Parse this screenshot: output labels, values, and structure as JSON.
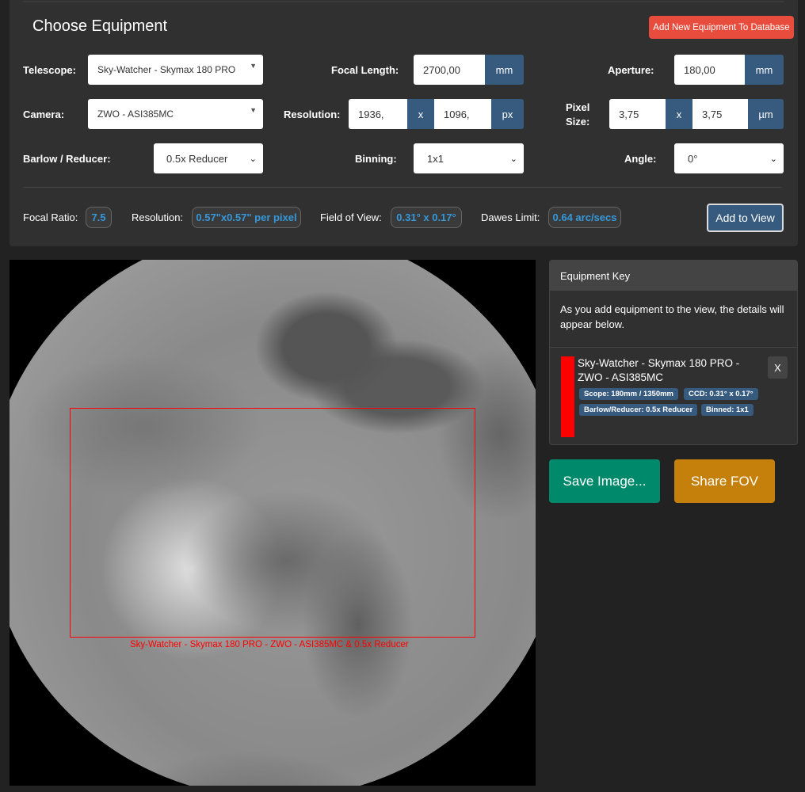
{
  "header": {
    "title": "Choose Equipment",
    "add_db_label": "Add New Equipment To Database"
  },
  "form": {
    "telescope": {
      "label": "Telescope:",
      "value": "Sky-Watcher - Skymax 180 PRO"
    },
    "focal_length": {
      "label": "Focal Length:",
      "value": "2700,00",
      "unit": "mm"
    },
    "aperture": {
      "label": "Aperture:",
      "value": "180,00",
      "unit": "mm"
    },
    "camera": {
      "label": "Camera:",
      "value": "ZWO - ASI385MC"
    },
    "resolution": {
      "label": "Resolution:",
      "x": "1936,",
      "sep": "x",
      "y": "1096,",
      "unit": "px"
    },
    "pixel_size": {
      "label_1": "Pixel",
      "label_2": "Size:",
      "x": "3,75",
      "sep": "x",
      "y": "3,75",
      "unit": "µm"
    },
    "barlow": {
      "label": "Barlow / Reducer:",
      "value": "0.5x Reducer"
    },
    "binning": {
      "label": "Binning:",
      "value": "1x1"
    },
    "angle": {
      "label": "Angle:",
      "value": "0°"
    }
  },
  "stats": {
    "focal_ratio": {
      "label": "Focal Ratio:",
      "value": "7.5"
    },
    "resolution": {
      "label": "Resolution:",
      "value": "0.57\"x0.57\" per pixel"
    },
    "fov": {
      "label": "Field of View:",
      "value": "0.31° x 0.17°"
    },
    "dawes": {
      "label": "Dawes Limit:",
      "value": "0.64 arc/secs"
    },
    "add_view_label": "Add to View"
  },
  "view": {
    "fov_label": "Sky-Watcher - Skymax 180 PRO - ZWO - ASI385MC  & 0.5x Reducer",
    "fov_color": "#ff0000"
  },
  "key": {
    "title": "Equipment Key",
    "description": "As you add equipment to the view, the details will appear below.",
    "entries": [
      {
        "name": "Sky-Watcher - Skymax 180 PRO - ZWO - ASI385MC",
        "color": "#ff0000",
        "remove": "X",
        "tags": [
          "Scope: 180mm / 1350mm",
          "CCD: 0.31° x 0.17°",
          "Barlow/Reducer: 0.5x Reducer",
          "Binned: 1x1"
        ]
      }
    ]
  },
  "actions": {
    "save_label": "Save Image...",
    "share_label": "Share FOV"
  }
}
